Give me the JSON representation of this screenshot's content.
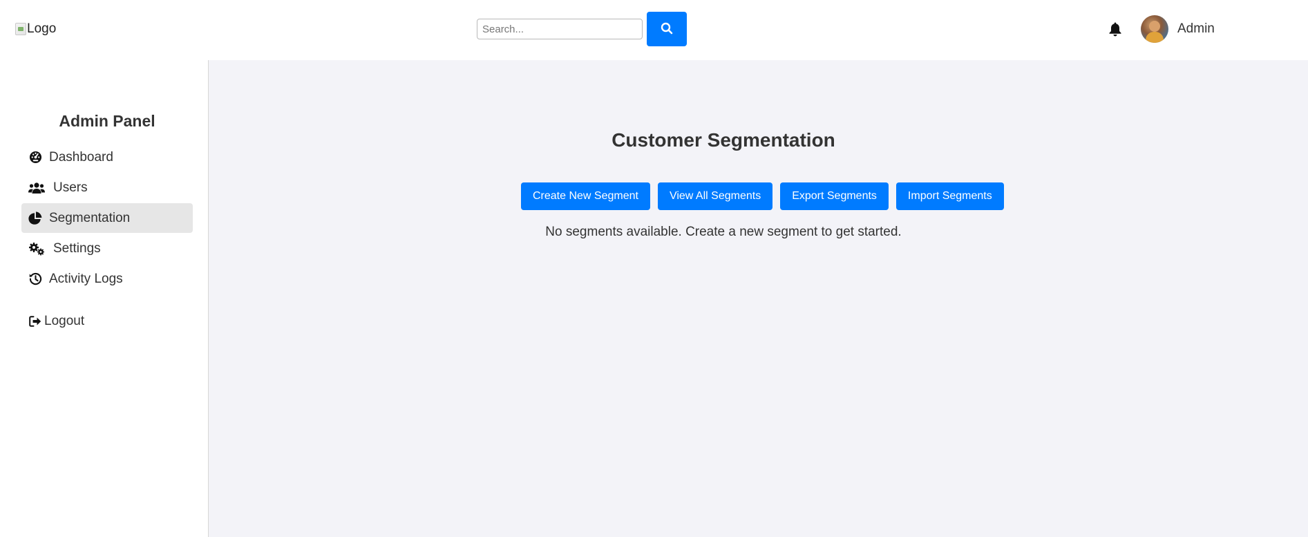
{
  "header": {
    "logo_alt": "Logo",
    "search": {
      "placeholder": "Search...",
      "value": ""
    },
    "search_icon": "search-icon",
    "notification_icon": "bell-icon",
    "user_name": "Admin"
  },
  "sidebar": {
    "title": "Admin Panel",
    "items": [
      {
        "label": "Dashboard",
        "icon": "dashboard-gauge-icon",
        "active": false
      },
      {
        "label": "Users",
        "icon": "users-icon",
        "active": false
      },
      {
        "label": "Segmentation",
        "icon": "pie-chart-icon",
        "active": true
      },
      {
        "label": "Settings",
        "icon": "gears-icon",
        "active": false
      },
      {
        "label": "Activity Logs",
        "icon": "history-icon",
        "active": false
      }
    ],
    "logout_label": "Logout",
    "logout_icon": "sign-out-icon"
  },
  "main": {
    "title": "Customer Segmentation",
    "actions": [
      "Create New Segment",
      "View All Segments",
      "Export Segments",
      "Import Segments"
    ],
    "empty_message": "No segments available. Create a new segment to get started."
  },
  "colors": {
    "accent": "#007bff",
    "main_bg": "#f3f3f8",
    "active_item_bg": "#e6e6e6",
    "text": "#333333"
  }
}
